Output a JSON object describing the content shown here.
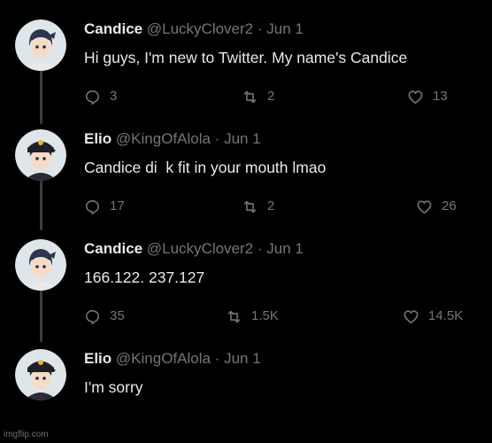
{
  "tweets": [
    {
      "name": "Candice",
      "handle": "@LuckyClover2",
      "separator": "·",
      "date": "Jun 1",
      "text": "Hi guys, I'm new to Twitter. My name's Candice",
      "replies": "3",
      "retweets": "2",
      "likes": "13",
      "avatar_icon": "candice-avatar-icon"
    },
    {
      "name": "Elio",
      "handle": "@KingOfAlola",
      "separator": "·",
      "date": "Jun 1",
      "text": "Candice di  k fit in your mouth lmao",
      "replies": "17",
      "retweets": "2",
      "likes": "26",
      "avatar_icon": "elio-avatar-icon"
    },
    {
      "name": "Candice",
      "handle": "@LuckyClover2",
      "separator": "·",
      "date": "Jun 1",
      "text": "166.122. 237.127",
      "replies": "35",
      "retweets": "1.5K",
      "likes": "14.5K",
      "avatar_icon": "candice-avatar-icon"
    },
    {
      "name": "Elio",
      "handle": "@KingOfAlola",
      "separator": "·",
      "date": "Jun 1",
      "text": "I'm sorry",
      "avatar_icon": "elio-avatar-icon"
    }
  ],
  "icons": {
    "reply": "reply-icon",
    "retweet": "retweet-icon",
    "like": "heart-icon"
  },
  "colors": {
    "background": "#000000",
    "primary_text": "#e7e9ea",
    "secondary_text": "#71767b",
    "thread_line": "#3a3d41"
  },
  "watermark": "imgflip.com"
}
